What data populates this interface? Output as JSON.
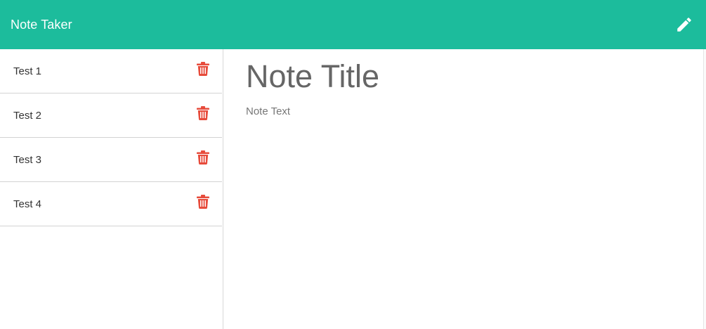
{
  "navbar": {
    "title": "Note Taker",
    "new_note_icon": "pencil-icon",
    "background_color": "#1cbc9c"
  },
  "sidebar": {
    "notes": [
      {
        "title": "Test 1",
        "delete_icon": "trash-icon"
      },
      {
        "title": "Test 2",
        "delete_icon": "trash-icon"
      },
      {
        "title": "Test 3",
        "delete_icon": "trash-icon"
      },
      {
        "title": "Test 4",
        "delete_icon": "trash-icon"
      }
    ],
    "delete_icon_color": "#e74c3c"
  },
  "editor": {
    "title_placeholder": "Note Title",
    "text_placeholder": "Note Text"
  }
}
